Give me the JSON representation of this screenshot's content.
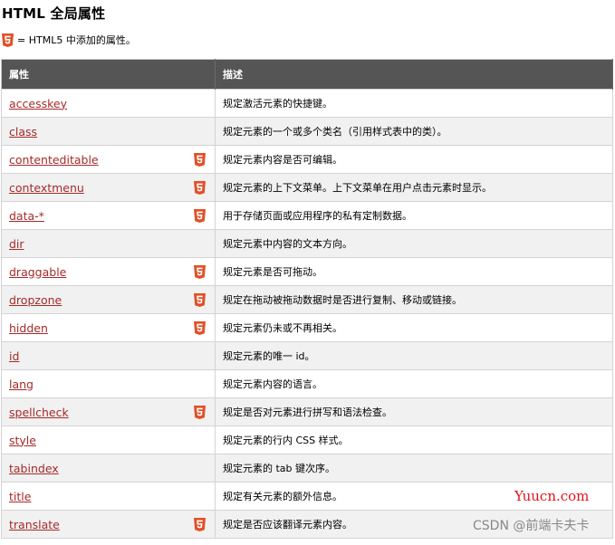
{
  "title": "HTML 全局属性",
  "legend": {
    "icon": "html5-icon",
    "text": "= HTML5 中添加的属性。"
  },
  "colors": {
    "header_bg": "#555555",
    "link": "#a52a2a",
    "html5_badge": "#e34f26",
    "watermark_red": "#e0141e"
  },
  "table": {
    "headers": [
      "属性",
      "描述"
    ],
    "rows": [
      {
        "attr": "accesskey",
        "html5": false,
        "desc": "规定激活元素的快捷键。"
      },
      {
        "attr": "class",
        "html5": false,
        "desc": "规定元素的一个或多个类名（引用样式表中的类）。"
      },
      {
        "attr": "contenteditable",
        "html5": true,
        "desc": "规定元素内容是否可编辑。"
      },
      {
        "attr": "contextmenu",
        "html5": true,
        "desc": "规定元素的上下文菜单。上下文菜单在用户点击元素时显示。"
      },
      {
        "attr": "data-*",
        "html5": true,
        "desc": "用于存储页面或应用程序的私有定制数据。"
      },
      {
        "attr": "dir",
        "html5": false,
        "desc": "规定元素中内容的文本方向。"
      },
      {
        "attr": "draggable",
        "html5": true,
        "desc": "规定元素是否可拖动。"
      },
      {
        "attr": "dropzone",
        "html5": true,
        "desc": "规定在拖动被拖动数据时是否进行复制、移动或链接。"
      },
      {
        "attr": "hidden",
        "html5": true,
        "desc": "规定元素仍未或不再相关。"
      },
      {
        "attr": "id",
        "html5": false,
        "desc": "规定元素的唯一 id。"
      },
      {
        "attr": "lang",
        "html5": false,
        "desc": "规定元素内容的语言。"
      },
      {
        "attr": "spellcheck",
        "html5": true,
        "desc": "规定是否对元素进行拼写和语法检查。"
      },
      {
        "attr": "style",
        "html5": false,
        "desc": "规定元素的行内 CSS 样式。"
      },
      {
        "attr": "tabindex",
        "html5": false,
        "desc": "规定元素的 tab 键次序。"
      },
      {
        "attr": "title",
        "html5": false,
        "desc": "规定有关元素的额外信息。"
      },
      {
        "attr": "translate",
        "html5": true,
        "desc": "规定是否应该翻译元素内容。"
      }
    ]
  },
  "watermarks": {
    "site": "Yuucn.com",
    "csdn": "CSDN @前端卡夫卡"
  }
}
